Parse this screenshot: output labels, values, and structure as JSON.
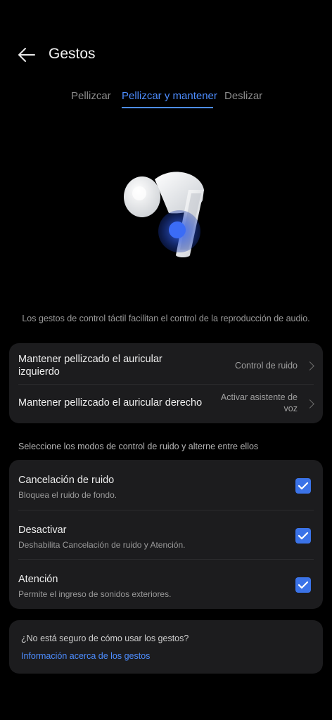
{
  "header": {
    "title": "Gestos",
    "back_icon": "arrow-left-icon"
  },
  "tabs": [
    {
      "label": "Pellizcar",
      "active": false
    },
    {
      "label": "Pellizcar y mantener",
      "active": true
    },
    {
      "label": "Deslizar",
      "active": false
    }
  ],
  "description": "Los gestos de control táctil facilitan el control de la reproducción de audio.",
  "gesture_settings": [
    {
      "label_line1": "Mantener pellizcado el auricular",
      "label_line2": "izquierdo",
      "value_line1": "Control de ruido",
      "value_line2": ""
    },
    {
      "label_line1": "Mantener pellizcado el auricular derecho",
      "label_line2": "",
      "value_line1": "Activar asistente de",
      "value_line2": "voz"
    }
  ],
  "noise_section": {
    "label": "Seleccione los modos de control de ruido y alterne entre ellos"
  },
  "noise_modes": [
    {
      "title": "Cancelación de ruido",
      "subtitle": "Bloquea el ruido de fondo.",
      "checked": true
    },
    {
      "title": "Desactivar",
      "subtitle": "Deshabilita Cancelación de ruido y Atención.",
      "checked": true
    },
    {
      "title": "Atención",
      "subtitle": "Permite el ingreso de sonidos exteriores.",
      "checked": true
    }
  ],
  "help": {
    "question": "¿No está seguro de cómo usar los gestos?",
    "link": "Información acerca de los gestos"
  },
  "colors": {
    "accent": "#4d8dff",
    "checkbox": "#3b73e8",
    "card": "#1c1c1e"
  }
}
